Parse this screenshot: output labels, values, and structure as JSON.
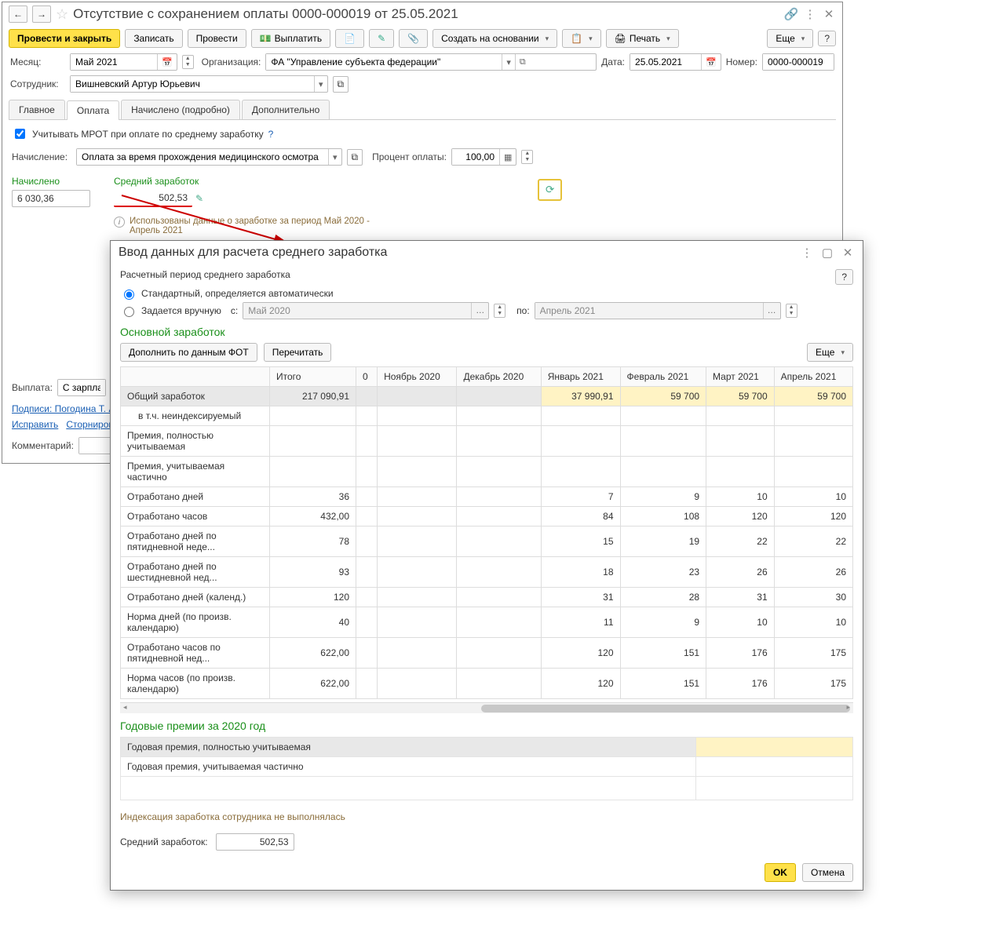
{
  "window": {
    "title": "Отсутствие с сохранением оплаты 0000-000019 от 25.05.2021"
  },
  "toolbar": {
    "post_close": "Провести и закрыть",
    "write": "Записать",
    "post": "Провести",
    "pay": "Выплатить",
    "create_based": "Создать на основании",
    "print": "Печать",
    "more": "Еще"
  },
  "header": {
    "month_label": "Месяц:",
    "month_value": "Май 2021",
    "org_label": "Организация:",
    "org_value": "ФА \"Управление субъекта федерации\"",
    "date_label": "Дата:",
    "date_value": "25.05.2021",
    "number_label": "Номер:",
    "number_value": "0000-000019",
    "employee_label": "Сотрудник:",
    "employee_value": "Вишневский Артур Юрьевич"
  },
  "tabs": [
    "Главное",
    "Оплата",
    "Начислено (подробно)",
    "Дополнительно"
  ],
  "active_tab": 1,
  "pane": {
    "mrot_checkbox": "Учитывать МРОТ при оплате по среднему заработку",
    "accrual_label": "Начисление:",
    "accrual_value": "Оплата за время прохождения медицинского осмотра",
    "percent_label": "Процент оплаты:",
    "percent_value": "100,00",
    "accrued_label": "Начислено",
    "accrued_value": "6 030,36",
    "avg_label": "Средний заработок",
    "avg_value": "502,53",
    "info_text": "Использованы данные о заработке за период Май 2020 - Апрель 2021",
    "payout_label": "Выплата:",
    "payout_value": "С зарплатой",
    "signatures": "Подписи: Погодина Т. А",
    "fix_link": "Исправить",
    "storno_link": "Сторнировать",
    "comment_label": "Комментарий:"
  },
  "dialog": {
    "title": "Ввод данных для расчета среднего заработка",
    "period_label": "Расчетный период среднего заработка",
    "radio_auto": "Стандартный, определяется автоматически",
    "radio_manual": "Задается вручную",
    "from_label": "с:",
    "from_value": "Май 2020",
    "to_label": "по:",
    "to_value": "Апрель 2021",
    "section_main": "Основной заработок",
    "btn_supplement": "Дополнить по данным ФОТ",
    "btn_recalc": "Перечитать",
    "btn_more": "Еще",
    "columns": [
      "Итого",
      "0",
      "Ноябрь 2020",
      "Декабрь 2020",
      "Январь 2021",
      "Февраль 2021",
      "Март 2021",
      "Апрель 2021"
    ],
    "rows": [
      {
        "label": "Общий заработок",
        "total": "217 090,91",
        "vals": [
          "",
          "",
          "",
          "37 990,91",
          "59 700",
          "59 700",
          "59 700"
        ],
        "highlight": true
      },
      {
        "label": "в т.ч. неиндексируемый",
        "total": "",
        "vals": [
          "",
          "",
          "",
          "",
          "",
          "",
          ""
        ],
        "sub": true
      },
      {
        "label": "Премия, полностью учитываемая",
        "total": "",
        "vals": [
          "",
          "",
          "",
          "",
          "",
          "",
          ""
        ]
      },
      {
        "label": "Премия, учитываемая частично",
        "total": "",
        "vals": [
          "",
          "",
          "",
          "",
          "",
          "",
          ""
        ]
      },
      {
        "label": "Отработано дней",
        "total": "36",
        "vals": [
          "",
          "",
          "",
          "7",
          "9",
          "10",
          "10"
        ]
      },
      {
        "label": "Отработано часов",
        "total": "432,00",
        "vals": [
          "",
          "",
          "",
          "84",
          "108",
          "120",
          "120"
        ]
      },
      {
        "label": "Отработано дней по пятидневной неде...",
        "total": "78",
        "vals": [
          "",
          "",
          "",
          "15",
          "19",
          "22",
          "22"
        ]
      },
      {
        "label": "Отработано дней по шестидневной нед...",
        "total": "93",
        "vals": [
          "",
          "",
          "",
          "18",
          "23",
          "26",
          "26"
        ]
      },
      {
        "label": "Отработано дней (календ.)",
        "total": "120",
        "vals": [
          "",
          "",
          "",
          "31",
          "28",
          "31",
          "30"
        ]
      },
      {
        "label": "Норма дней (по произв. календарю)",
        "total": "40",
        "vals": [
          "",
          "",
          "",
          "11",
          "9",
          "10",
          "10"
        ]
      },
      {
        "label": "Отработано часов по пятидневной нед...",
        "total": "622,00",
        "vals": [
          "",
          "",
          "",
          "120",
          "151",
          "176",
          "175"
        ]
      },
      {
        "label": "Норма часов (по произв. календарю)",
        "total": "622,00",
        "vals": [
          "",
          "",
          "",
          "120",
          "151",
          "176",
          "175"
        ]
      }
    ],
    "section_annual": "Годовые премии за 2020 год",
    "annual_rows": [
      "Годовая премия, полностью учитываемая",
      "Годовая премия, учитываемая частично"
    ],
    "indexation_note": "Индексация заработка сотрудника не выполнялась",
    "avg_footer_label": "Средний заработок:",
    "avg_footer_value": "502,53",
    "ok": "OK",
    "cancel": "Отмена"
  }
}
